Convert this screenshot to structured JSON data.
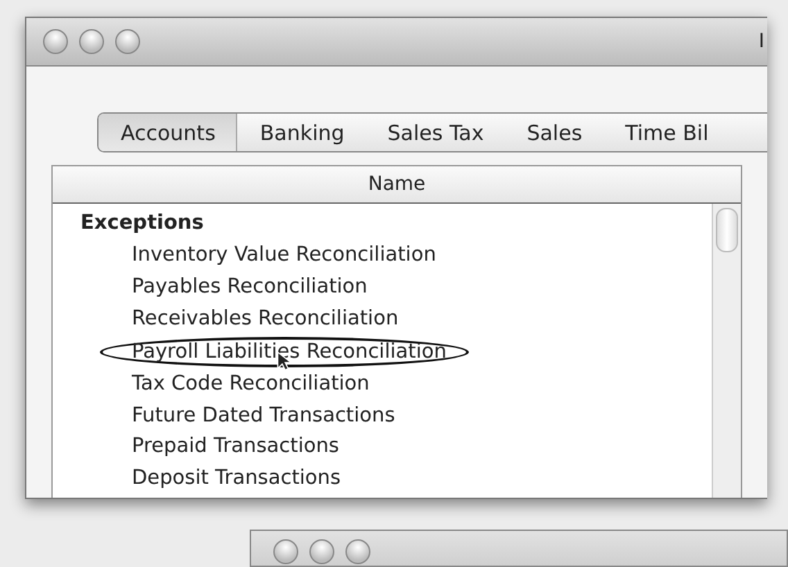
{
  "window": {
    "title": "I"
  },
  "tabs": [
    {
      "label": "Accounts",
      "selected": true
    },
    {
      "label": "Banking",
      "selected": false
    },
    {
      "label": "Sales Tax",
      "selected": false
    },
    {
      "label": "Sales",
      "selected": false
    },
    {
      "label": "Time Bil",
      "selected": false
    }
  ],
  "table": {
    "columns": [
      "Name"
    ],
    "rows": [
      {
        "label": "Exceptions",
        "circled": false,
        "children": [
          {
            "label": "Inventory Value Reconciliation",
            "circled": false
          },
          {
            "label": "Payables Reconciliation",
            "circled": false
          },
          {
            "label": "Receivables Reconciliation",
            "circled": false
          },
          {
            "label": "Payroll Liabilities Reconciliation",
            "circled": true
          },
          {
            "label": "Tax Code Reconciliation",
            "circled": false
          },
          {
            "label": "Future Dated Transactions",
            "circled": false
          },
          {
            "label": "Prepaid Transactions",
            "circled": false
          },
          {
            "label": "Deposit Transactions",
            "circled": false
          }
        ]
      }
    ]
  }
}
